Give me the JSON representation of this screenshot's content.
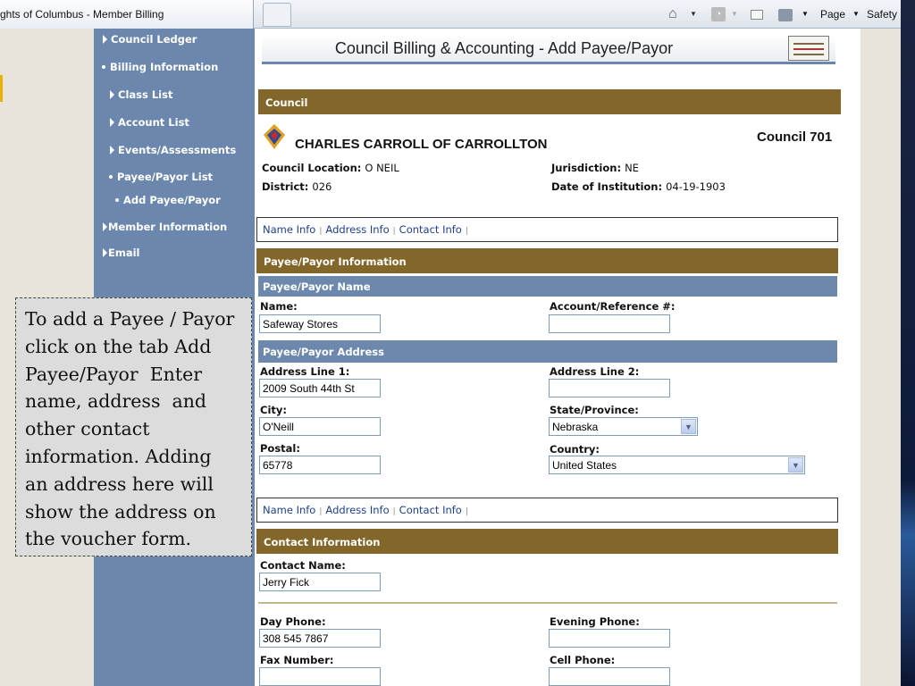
{
  "browser": {
    "tab_title": "ghts of Columbus - Member Billing",
    "toolbar": {
      "page_label": "Page",
      "safety_label": "Safety"
    }
  },
  "sidebar": {
    "items": [
      {
        "label": "Council Ledger"
      },
      {
        "label": "Billing Information"
      },
      {
        "label": "Class List"
      },
      {
        "label": "Account List"
      },
      {
        "label": "Events/Assessments"
      },
      {
        "label": "Payee/Payor List"
      },
      {
        "label": "Add Payee/Payor"
      },
      {
        "label": "Member Information"
      },
      {
        "label": "Email"
      }
    ]
  },
  "page": {
    "title": "Council Billing & Accounting - Add Payee/Payor"
  },
  "council": {
    "section_label": "Council",
    "name": "CHARLES CARROLL OF CARROLLTON",
    "number": "Council 701",
    "location_label": "Council Location:",
    "location": "O NEIL",
    "jurisdiction_label": "Jurisdiction:",
    "jurisdiction": "NE",
    "district_label": "District:",
    "district": "026",
    "institution_label": "Date of Institution:",
    "institution_date": "04-19-1903"
  },
  "tabnav": {
    "name_info": "Name Info",
    "address_info": "Address Info",
    "contact_info": "Contact Info"
  },
  "payee": {
    "section_label": "Payee/Payor Information",
    "name_section": "Payee/Payor Name",
    "name_label": "Name:",
    "name_value": "Safeway Stores",
    "account_label": "Account/Reference #:",
    "account_value": "",
    "address_section": "Payee/Payor Address",
    "address1_label": "Address Line 1:",
    "address1_value": "2009 South 44th St",
    "address2_label": "Address Line 2:",
    "address2_value": "",
    "city_label": "City:",
    "city_value": "O'Neill",
    "state_label": "State/Province:",
    "state_value": "Nebraska",
    "postal_label": "Postal:",
    "postal_value": "65778",
    "country_label": "Country:",
    "country_value": "United States"
  },
  "contact": {
    "section_label": "Contact Information",
    "contact_name_label": "Contact Name:",
    "contact_name_value": "Jerry Fick",
    "day_phone_label": "Day Phone:",
    "day_phone_value": "308 545 7867",
    "evening_phone_label": "Evening Phone:",
    "evening_phone_value": "",
    "fax_label": "Fax Number:",
    "fax_value": "",
    "cell_label": "Cell Phone:",
    "cell_value": ""
  },
  "callout": {
    "lines": [
      "To add a Payee / Payor",
      "click on the tab Add",
      "Payee/Payor  Enter",
      "name, address  and",
      "other contact",
      "information. Adding",
      "an address here will",
      "show the address on",
      "the voucher form."
    ]
  }
}
